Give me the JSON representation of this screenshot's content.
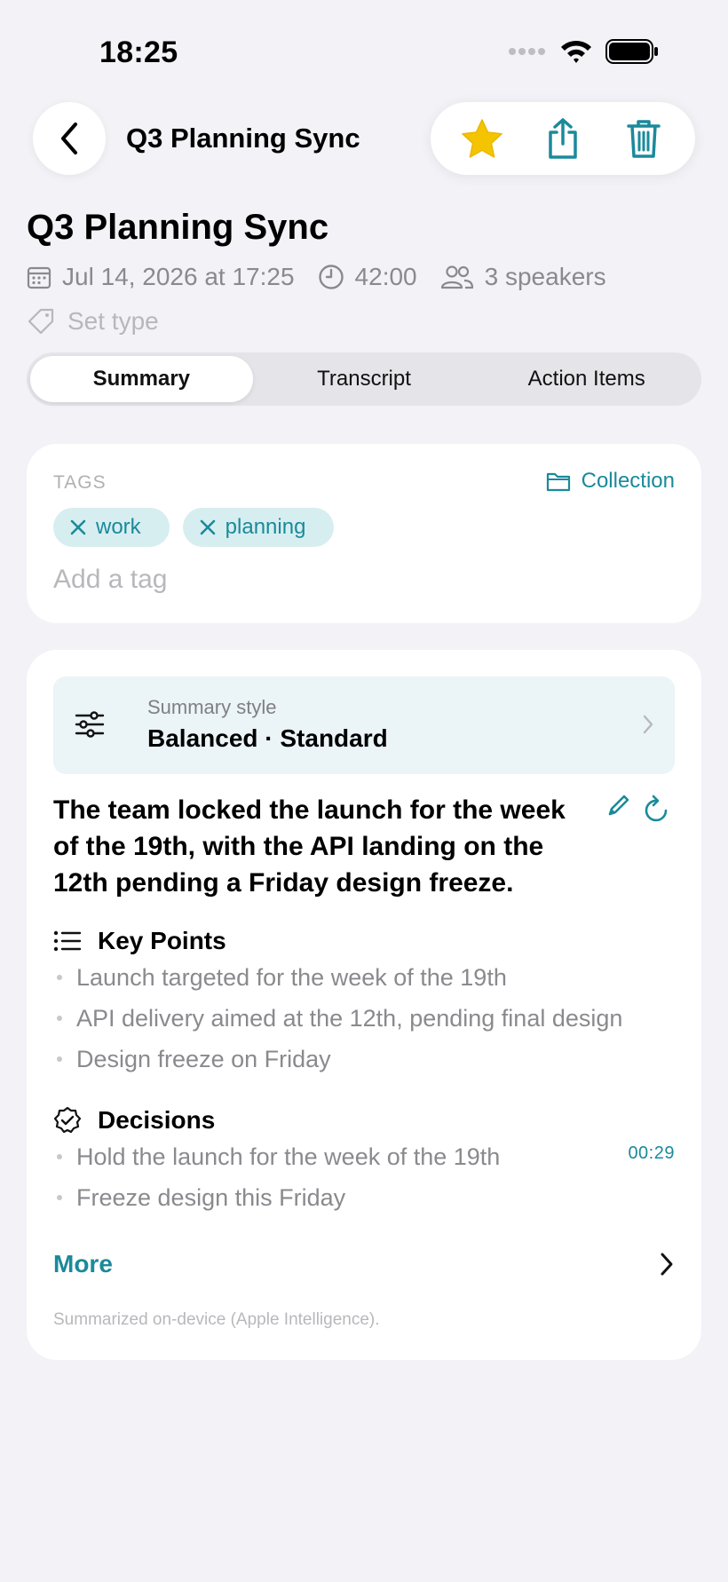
{
  "status_bar": {
    "time": "18:25"
  },
  "nav": {
    "title": "Q3 Planning Sync"
  },
  "header": {
    "title": "Q3 Planning Sync",
    "date": "Jul 14, 2026 at 17:25",
    "duration": "42:00",
    "speakers": "3 speakers",
    "set_type": "Set type"
  },
  "tabs": [
    {
      "label": "Summary"
    },
    {
      "label": "Transcript"
    },
    {
      "label": "Action Items"
    }
  ],
  "tags_card": {
    "label": "TAGS",
    "collection": "Collection",
    "tags": [
      "work",
      "planning"
    ],
    "add_placeholder": "Add a tag"
  },
  "summary_card": {
    "style_label": "Summary style",
    "style_value": "Balanced · Standard",
    "headline": "The team locked the launch for the week of the 19th, with the API landing on the 12th pending a Friday design freeze.",
    "key_points_title": "Key Points",
    "key_points": [
      "Launch targeted for the week of the 19th",
      "API delivery aimed at the 12th, pending final design",
      "Design freeze on Friday"
    ],
    "decisions_title": "Decisions",
    "decisions": [
      "Hold the launch for the week of the 19th",
      "Freeze design this Friday"
    ],
    "decision_timestamp": "00:29",
    "more_label": "More",
    "footnote": "Summarized on-device (Apple Intelligence)."
  },
  "colors": {
    "accent": "#1A8A9B",
    "star": "#F5C400",
    "background": "#F2F2F7",
    "chip_bg": "#D7EEF0"
  },
  "icons": [
    "calendar-icon",
    "clock-icon",
    "people-icon",
    "tag-icon",
    "star-icon",
    "share-icon",
    "trash-icon",
    "folder-icon",
    "close-icon",
    "sliders-icon",
    "chevron-right-icon",
    "pencil-icon",
    "refresh-icon",
    "list-icon",
    "badge-check-icon",
    "back-chevron-icon"
  ]
}
